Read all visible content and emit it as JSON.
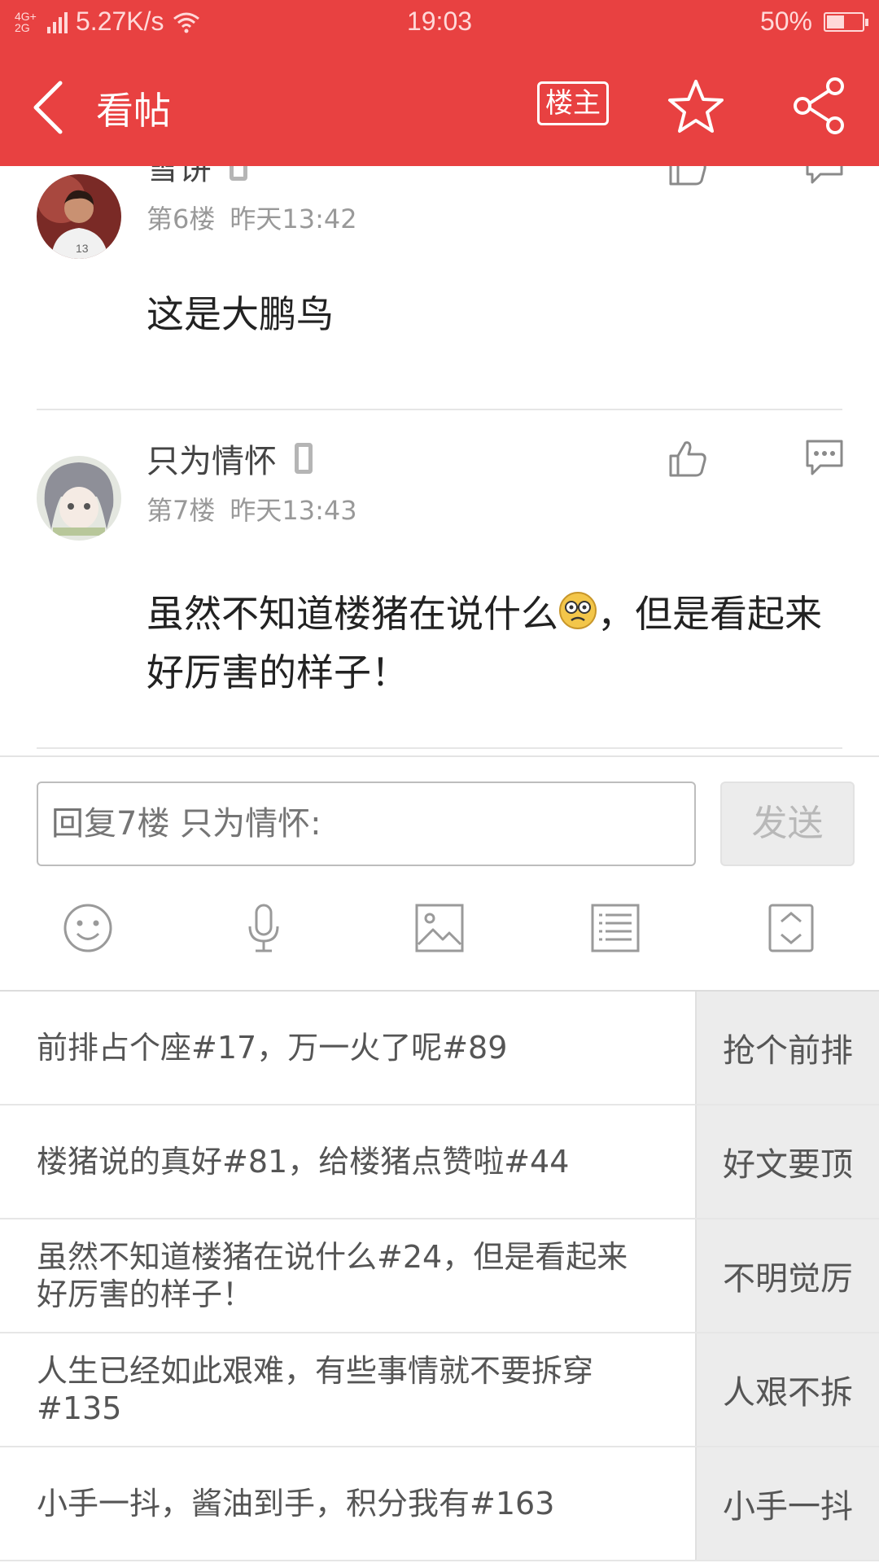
{
  "status_bar": {
    "network": "4G+ 2G",
    "speed": "5.27K/s",
    "time": "19:03",
    "battery_percent": "50%",
    "battery_level": 0.5
  },
  "header": {
    "title": "看帖",
    "owner_label": "楼主",
    "back_icon": "back-arrow-icon",
    "star_icon": "star-icon",
    "share_icon": "share-icon",
    "bg_color": "#e84141"
  },
  "posts": [
    {
      "username": "雪饼",
      "floor": "第6楼",
      "time": "昨天13:42",
      "content": "这是大鹏鸟"
    },
    {
      "username": "只为情怀",
      "floor": "第7楼",
      "time": "昨天13:43",
      "content_before": "虽然不知道楼猪在说什么",
      "content_after": "，但是看起来好厉害的样子！",
      "emoji": "confused-face-emoji"
    }
  ],
  "reply": {
    "placeholder": "回复7楼 只为情怀:",
    "send_label": "发送",
    "tools": [
      "emoji-icon",
      "microphone-icon",
      "image-icon",
      "list-icon",
      "expand-icon"
    ]
  },
  "quick_replies": [
    {
      "text": "前排占个座#17，万一火了呢#89",
      "tag": "抢个前排"
    },
    {
      "text": "楼猪说的真好#81，给楼猪点赞啦#44",
      "tag": "好文要顶"
    },
    {
      "text": "虽然不知道楼猪在说什么#24，但是看起来好厉害的样子！",
      "tag": "不明觉厉"
    },
    {
      "text": "人生已经如此艰难，有些事情就不要拆穿#135",
      "tag": "人艰不拆"
    },
    {
      "text": "小手一抖，酱油到手，积分我有#163",
      "tag": "小手一抖"
    }
  ]
}
